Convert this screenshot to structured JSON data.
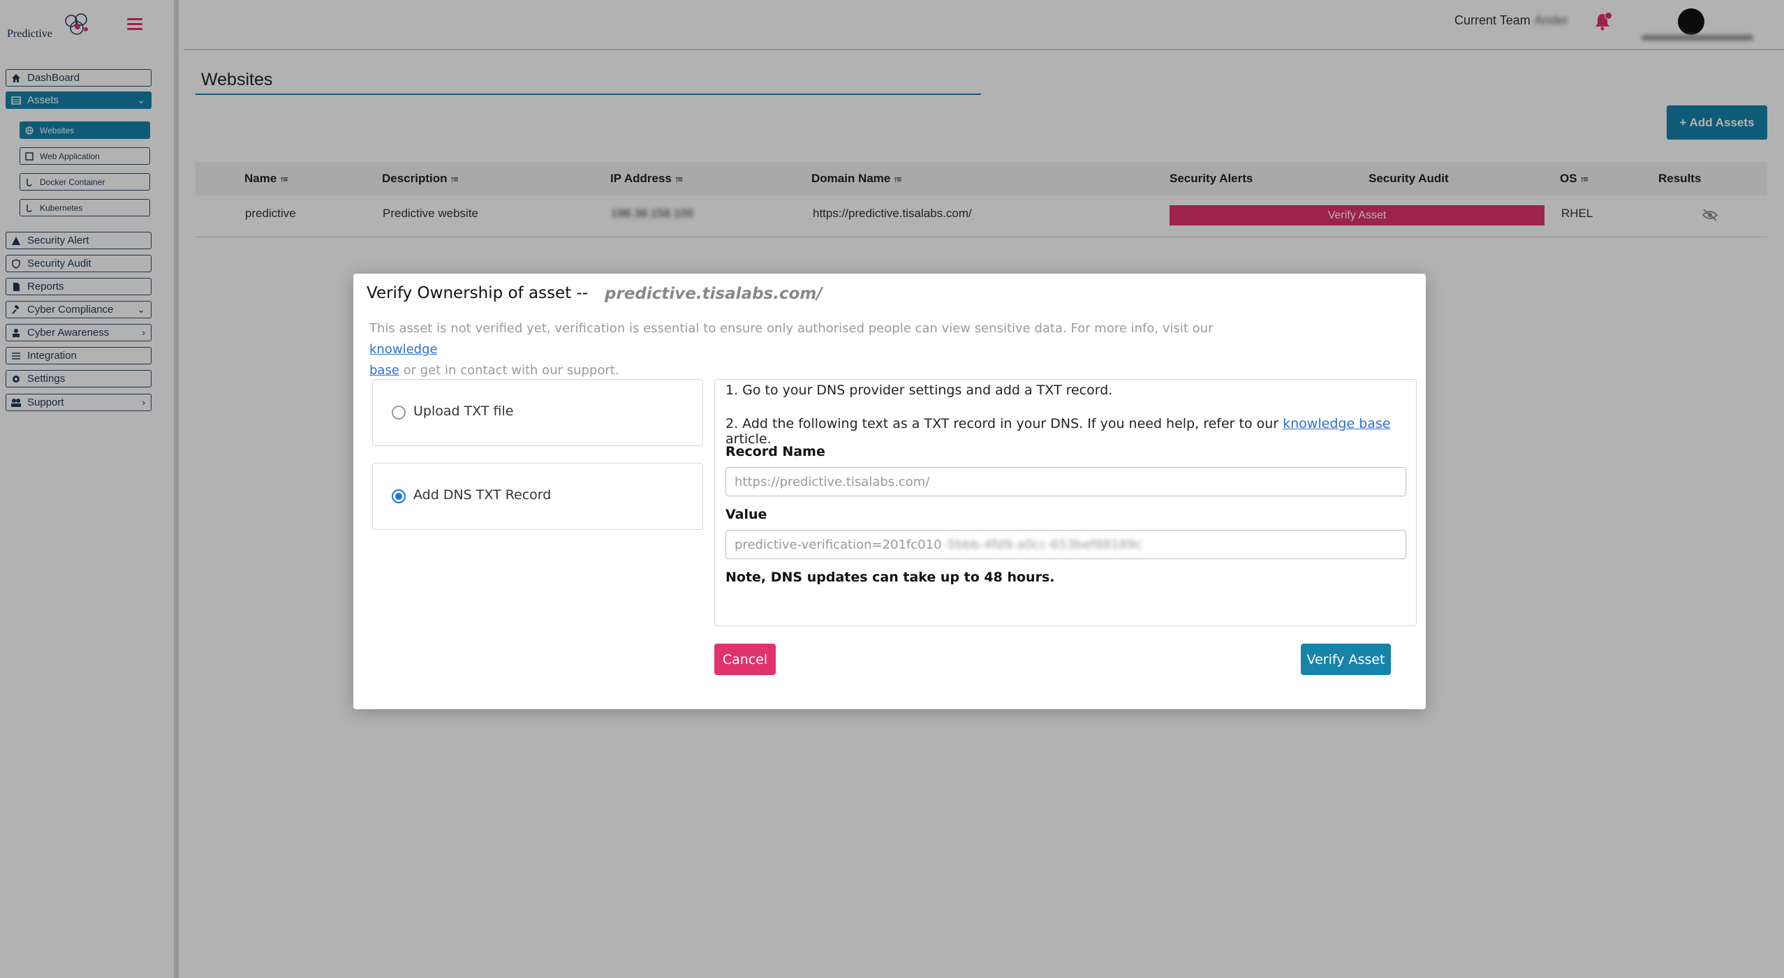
{
  "app": {
    "logo_text": "Predictive",
    "colors": {
      "primary": "#1683ab",
      "accent": "#e0336e"
    }
  },
  "sidebar": {
    "items": [
      {
        "label": "DashBoard",
        "icon": "home-icon"
      },
      {
        "label": "Assets",
        "icon": "table-icon",
        "active": true
      },
      {
        "label": "Security Alert",
        "icon": "warning-icon"
      },
      {
        "label": "Security Audit",
        "icon": "shield-icon"
      },
      {
        "label": "Reports",
        "icon": "file-icon"
      },
      {
        "label": "Cyber Compliance",
        "icon": "gavel-icon"
      },
      {
        "label": "Cyber Awareness",
        "icon": "people-icon"
      },
      {
        "label": "Integration",
        "icon": "sliders-icon"
      },
      {
        "label": "Settings",
        "icon": "gear-icon"
      },
      {
        "label": "Support",
        "icon": "users-icon"
      }
    ],
    "subitems": [
      {
        "label": "Websites",
        "icon": "globe-icon",
        "active": true
      },
      {
        "label": "Web Application",
        "icon": "window-icon"
      },
      {
        "label": "Docker Container",
        "icon": "docker-icon"
      },
      {
        "label": "Kubernetes",
        "icon": "kubernetes-icon"
      }
    ]
  },
  "topbar": {
    "team_label": "Current Team",
    "team_name": "Ander"
  },
  "page": {
    "title": "Websites",
    "add_button": "+ Add Assets"
  },
  "table": {
    "headers": [
      "Name",
      "Description",
      "IP Address",
      "Domain Name",
      "Security Alerts",
      "Security Audit",
      "OS",
      "Results"
    ],
    "rows": [
      {
        "name": "predictive",
        "description": "Predictive website",
        "ip": "198.38.158.100",
        "domain": "https://predictive.tisalabs.com/",
        "security_alerts": "Verify Asset",
        "os": "RHEL"
      }
    ]
  },
  "modal": {
    "title": "Verify Ownership of asset --",
    "domain": "predictive.tisalabs.com/",
    "desc_part1": "This asset is not verified yet, verification is essential to ensure only authorised people can view sensitive data. For more info, visit our ",
    "desc_link1": "knowledge",
    "desc_link2": "base",
    "desc_part2": " or get in contact with our support.",
    "option_upload": "Upload TXT file",
    "option_dns": "Add DNS TXT Record",
    "step1": "1. Go to your DNS provider settings and add a TXT record.",
    "step2_part1": "2. Add the following text as a TXT record in your DNS. If you need help, refer to our ",
    "step2_link": "knowledge base",
    "step2_part2": " article.",
    "record_name_label": "Record Name",
    "record_name_value": "https://predictive.tisalabs.com/",
    "value_label": "Value",
    "value_prefix": "predictive-verification=201fc010",
    "value_rest": "-5bbb-4fd9-a0cc-653bef88189c",
    "note": "Note, DNS updates can take up to 48 hours.",
    "cancel": "Cancel",
    "verify": "Verify Asset"
  }
}
